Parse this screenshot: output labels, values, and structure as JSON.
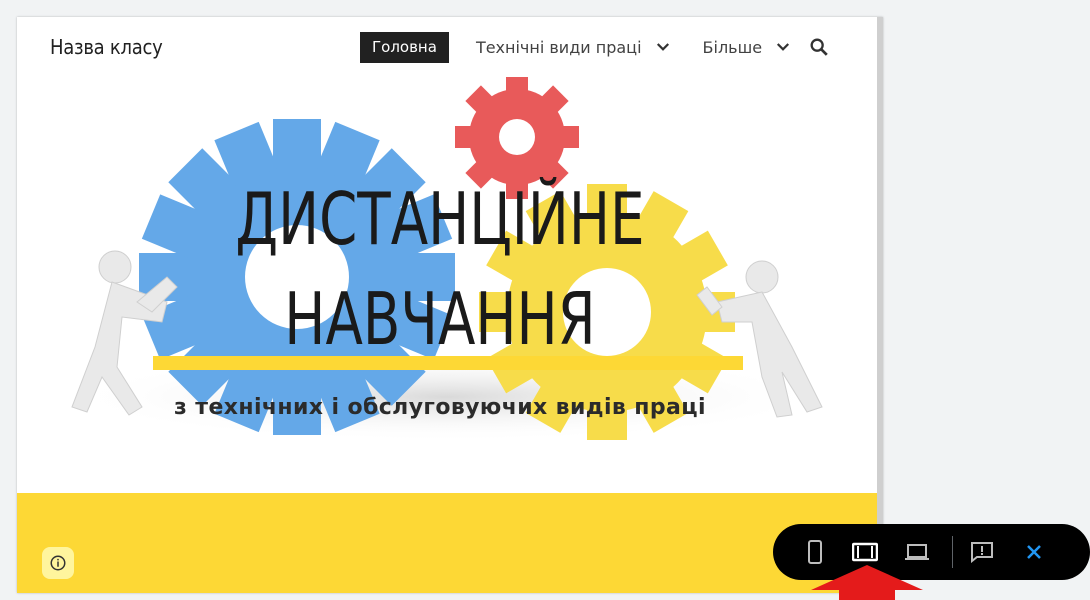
{
  "header": {
    "site_title": "Назва класу",
    "nav": [
      {
        "label": "Головна",
        "active": true
      },
      {
        "label": "Технічні види праці",
        "has_dropdown": true
      },
      {
        "label": "Більше",
        "has_dropdown": true
      }
    ],
    "search_icon": "search-icon"
  },
  "hero": {
    "title_line1": "ДИСТАНЦІЙНЕ",
    "title_line2": "НАВЧАННЯ",
    "subtitle": "з технічних і обслуговуючих видів праці",
    "accent_color": "#fdd835",
    "gear_colors": [
      "#64a8e8",
      "#ef5350",
      "#fdd835"
    ]
  },
  "footer": {
    "info_icon": "info-icon"
  },
  "preview_toolbar": {
    "buttons": [
      "phone-icon",
      "tablet-icon",
      "laptop-icon",
      "feedback-icon",
      "close-icon"
    ],
    "selected": "tablet-icon"
  }
}
